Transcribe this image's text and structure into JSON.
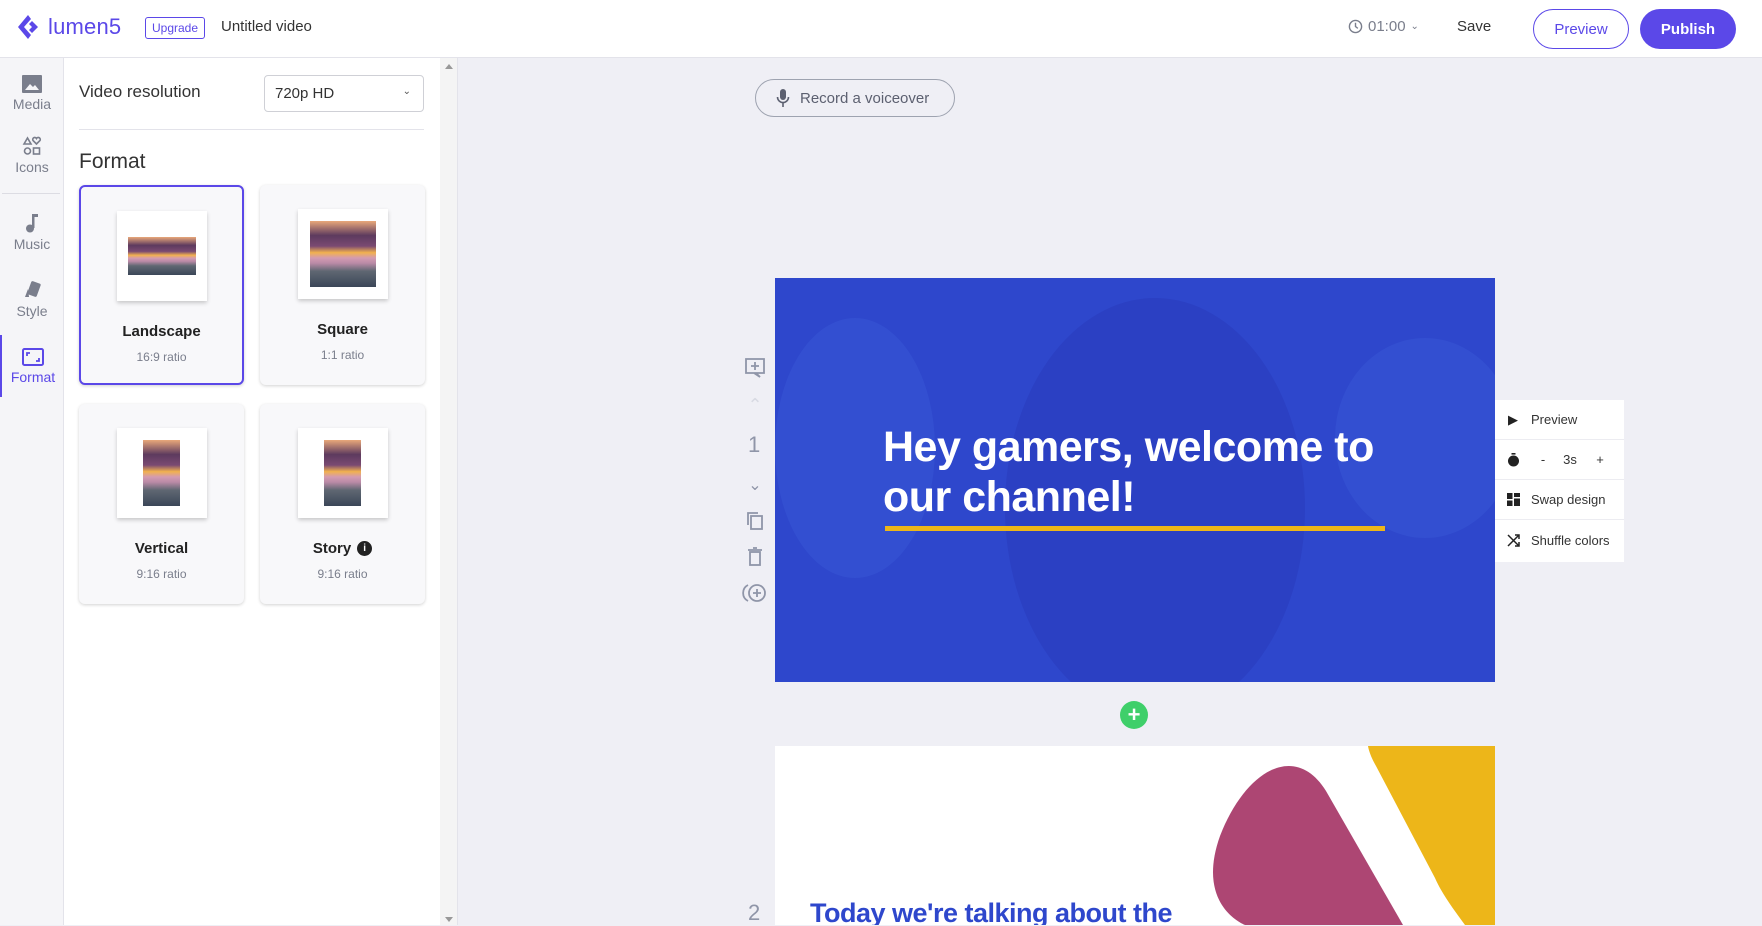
{
  "header": {
    "logo_text": "lumen5",
    "upgrade_label": "Upgrade",
    "title": "Untitled video",
    "duration": "01:00",
    "save_label": "Save",
    "preview_label": "Preview",
    "publish_label": "Publish"
  },
  "rail": {
    "items": [
      {
        "label": "Media",
        "icon": "image-icon"
      },
      {
        "label": "Icons",
        "icon": "shapes-icon"
      },
      {
        "label": "Music",
        "icon": "music-note-icon"
      },
      {
        "label": "Style",
        "icon": "style-swatch-icon"
      },
      {
        "label": "Format",
        "icon": "aspect-ratio-icon",
        "active": true
      }
    ]
  },
  "panel": {
    "resolution_label": "Video resolution",
    "resolution_value": "720p HD",
    "format_title": "Format",
    "formats": [
      {
        "name": "Landscape",
        "ratio": "16:9 ratio",
        "selected": true
      },
      {
        "name": "Square",
        "ratio": "1:1 ratio",
        "selected": false
      },
      {
        "name": "Vertical",
        "ratio": "9:16 ratio",
        "selected": false
      },
      {
        "name": "Story",
        "ratio": "9:16 ratio",
        "selected": false,
        "info": true
      }
    ]
  },
  "canvas": {
    "voiceover_label": "Record a voiceover",
    "scenes": [
      {
        "number": "1",
        "text": "Hey gamers, welcome to our channel!",
        "background": "#2e47cc",
        "accent": "#edb619"
      },
      {
        "number": "2",
        "text": "Today we're talking about the",
        "background": "#ffffff",
        "accent": "#ad4673"
      }
    ],
    "scene_menu": {
      "preview_label": "Preview",
      "duration_minus": "-",
      "duration_value": "3s",
      "duration_plus": "+",
      "swap_label": "Swap design",
      "shuffle_label": "Shuffle colors"
    }
  },
  "colors": {
    "brand": "#5b48e8",
    "add_scene": "#3fcf6a"
  }
}
